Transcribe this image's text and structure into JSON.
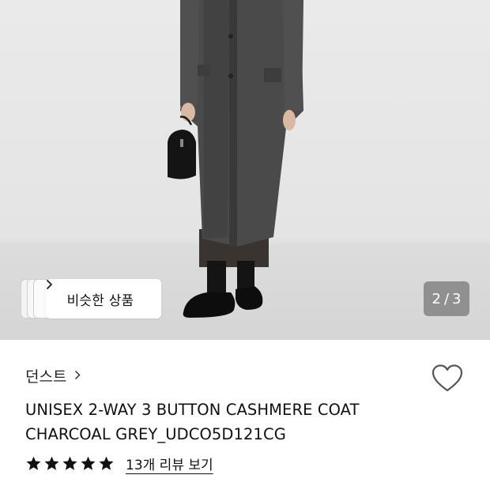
{
  "gallery": {
    "similar_label": "비슷한 상품",
    "counter_current": "2",
    "counter_separator": "/",
    "counter_total": "3"
  },
  "product": {
    "brand": "던스트",
    "title_line1": "UNISEX 2-WAY 3 BUTTON CASHMERE COAT",
    "title_line2": "CHARCOAL GREY_UDCO5D121CG",
    "rating_stars": 5,
    "review_link": "13개 리뷰 보기",
    "is_wishlisted": false
  },
  "colors": {
    "star": "#111111",
    "counter_bg": "#808080",
    "text": "#111111"
  },
  "icons": {
    "chevron": "chevron-right-icon",
    "heart": "heart-outline-icon",
    "star": "star-filled-icon"
  }
}
